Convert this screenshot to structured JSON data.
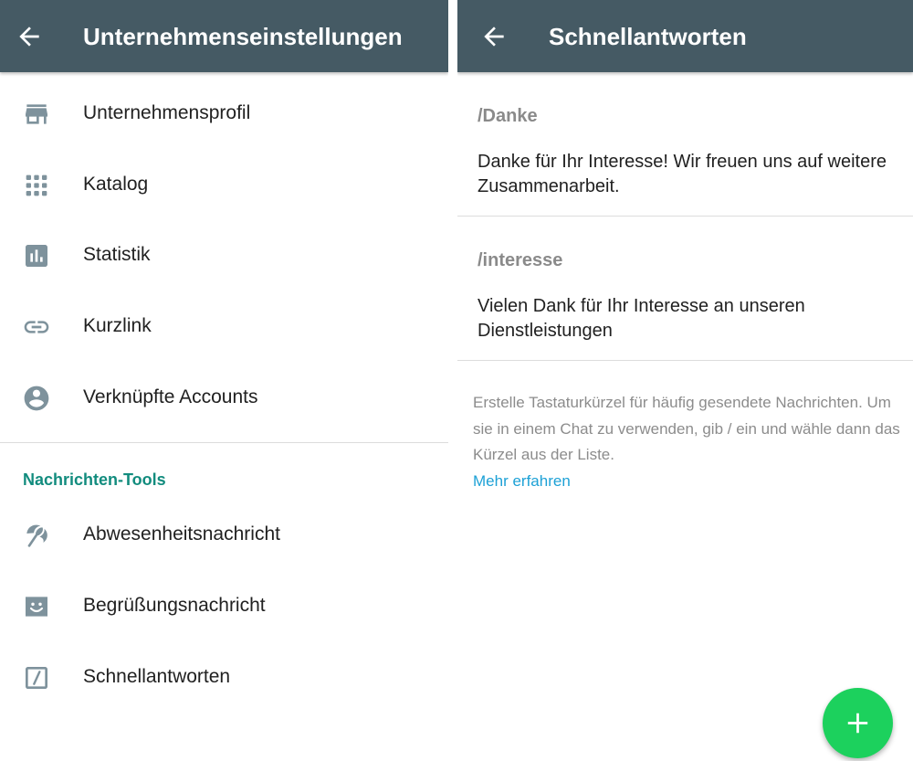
{
  "colors": {
    "appbar": "#455a64",
    "accent": "#128c7e",
    "link": "#1da1d6",
    "fab": "#1cd15d",
    "icon": "#7e929c"
  },
  "left_screen": {
    "appbar": {
      "back_icon": "arrow-left-icon",
      "title": "Unternehmenseinstellungen"
    },
    "items": [
      {
        "icon": "store-icon",
        "label": "Unternehmensprofil"
      },
      {
        "icon": "grid-icon",
        "label": "Katalog"
      },
      {
        "icon": "bar-chart-icon",
        "label": "Statistik"
      },
      {
        "icon": "link-icon",
        "label": "Kurzlink"
      },
      {
        "icon": "account-circle-icon",
        "label": "Verknüpfte Accounts"
      }
    ],
    "section_header": "Nachrichten-Tools",
    "tools": [
      {
        "icon": "umbrella-icon",
        "label": "Abwesenheitsnachricht"
      },
      {
        "icon": "smiley-icon",
        "label": "Begrüßungsnachricht"
      },
      {
        "icon": "slash-box-icon",
        "label": "Schnellantworten"
      }
    ]
  },
  "right_screen": {
    "appbar": {
      "back_icon": "arrow-left-icon",
      "title": "Schnellantworten"
    },
    "replies": [
      {
        "shortcut": "/Danke",
        "message": "Danke für Ihr Interesse! Wir freuen uns auf weitere Zusammenarbeit."
      },
      {
        "shortcut": "/interesse",
        "message": "Vielen Dank für Ihr Interesse an unseren Dienstleistungen"
      }
    ],
    "info_text": "Erstelle Tastaturkürzel für häufig gesendete Nachrichten. Um sie in einem Chat zu verwenden, gib / ein und wähle dann das Kürzel aus der Liste.",
    "info_link": "Mehr erfahren",
    "fab_icon": "plus-icon"
  }
}
